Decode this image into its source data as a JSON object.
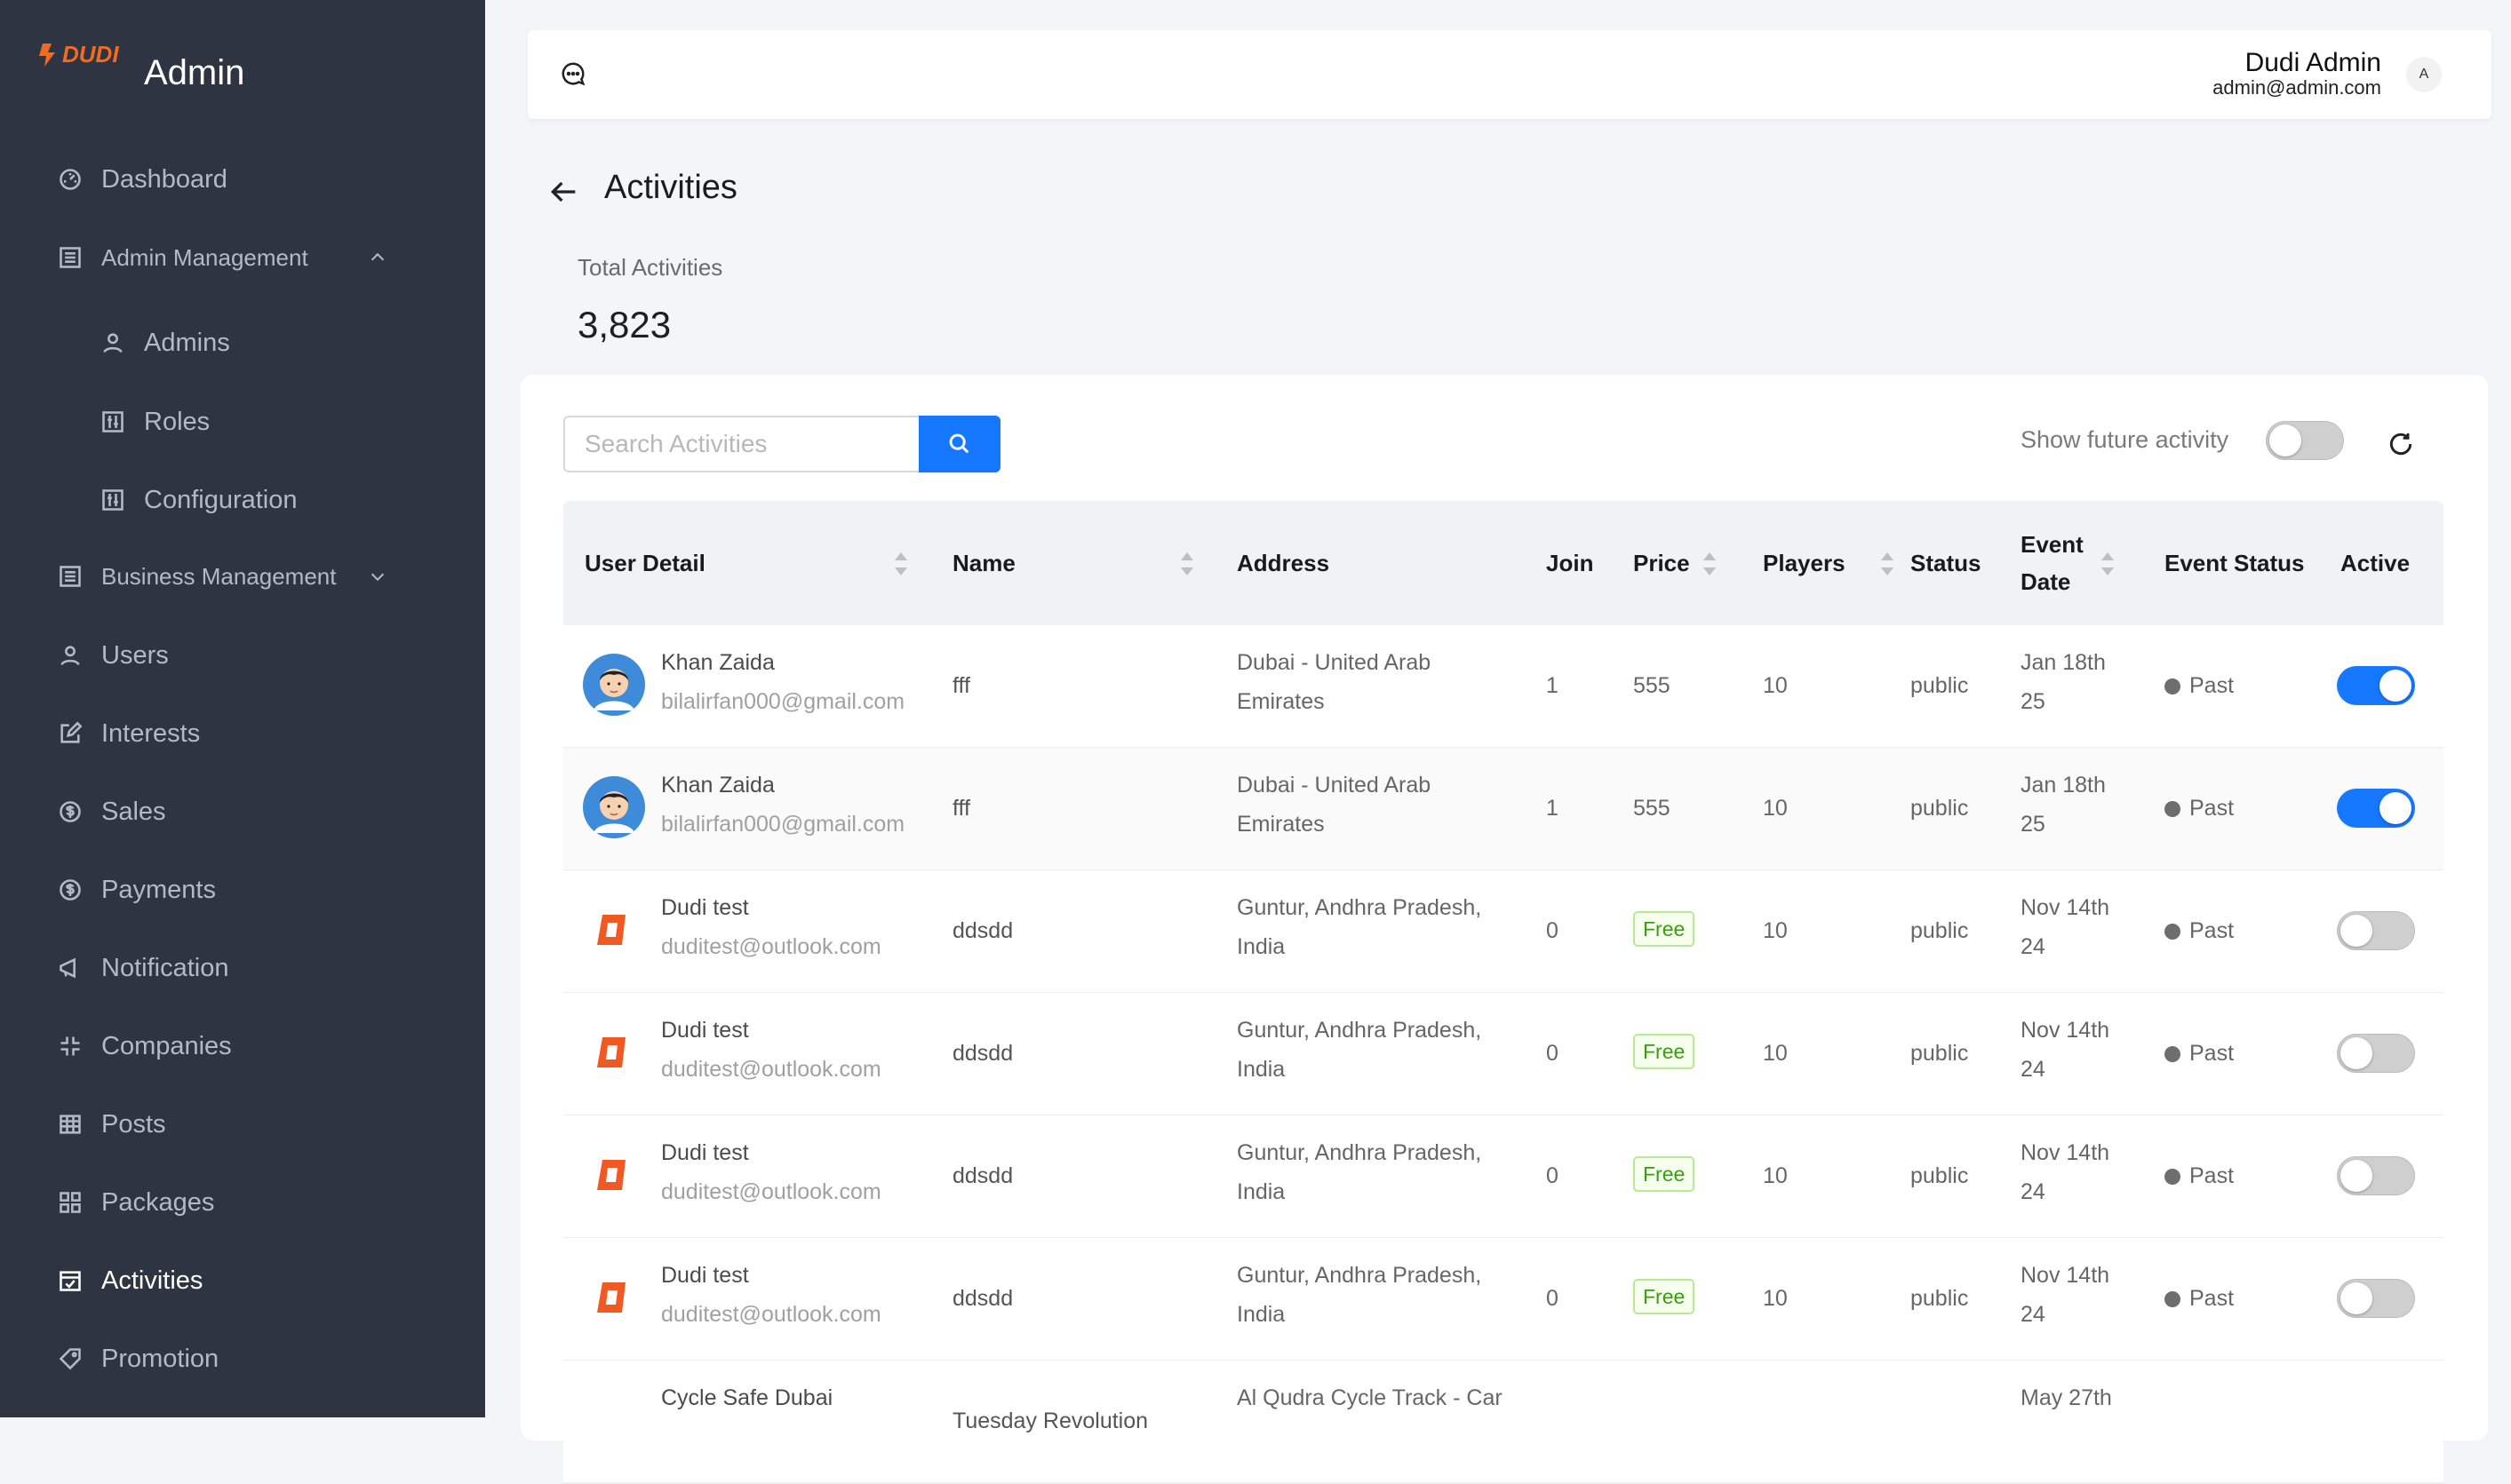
{
  "app": {
    "brand_logo_text": "DUDI",
    "title": "Admin"
  },
  "sidebar": {
    "items": [
      {
        "label": "Dashboard",
        "icon": "dashboard-icon"
      },
      {
        "label": "Admin Management",
        "icon": "list-icon",
        "expanded": true
      },
      {
        "label": "Admins",
        "icon": "user-icon"
      },
      {
        "label": "Roles",
        "icon": "settings-box-icon"
      },
      {
        "label": "Configuration",
        "icon": "settings-box-icon"
      },
      {
        "label": "Business Management",
        "icon": "list-icon",
        "expanded": false
      },
      {
        "label": "Users",
        "icon": "user-icon"
      },
      {
        "label": "Interests",
        "icon": "edit-icon"
      },
      {
        "label": "Sales",
        "icon": "dollar-circle-icon"
      },
      {
        "label": "Payments",
        "icon": "dollar-circle-icon"
      },
      {
        "label": "Notification",
        "icon": "megaphone-icon"
      },
      {
        "label": "Companies",
        "icon": "compress-icon"
      },
      {
        "label": "Posts",
        "icon": "table-icon"
      },
      {
        "label": "Packages",
        "icon": "grid-icon"
      },
      {
        "label": "Activities",
        "icon": "calendar-check-icon",
        "active": true
      },
      {
        "label": "Promotion",
        "icon": "tag-icon"
      }
    ]
  },
  "header": {
    "user_name": "Dudi Admin",
    "user_email": "admin@admin.com",
    "avatar_initial": "A"
  },
  "page": {
    "title": "Activities",
    "total_label": "Total Activities",
    "total_value": "3,823"
  },
  "toolbar": {
    "search_placeholder": "Search Activities",
    "future_label": "Show future activity",
    "future_enabled": false
  },
  "table": {
    "columns": [
      "User Detail",
      "Name",
      "Address",
      "Join",
      "Price",
      "Players",
      "Status",
      "Event Date",
      "Event Status",
      "Active"
    ],
    "event_date_header_lines": [
      "Event",
      "Date"
    ],
    "rows": [
      {
        "user_name": "Khan Zaida",
        "user_email": "bilalirfan000@gmail.com",
        "avatar": "person",
        "name": "fff",
        "address_1": "Dubai - United Arab",
        "address_2": "Emirates",
        "join": "1",
        "price": "555",
        "players": "10",
        "status": "public",
        "date_1": "Jan 18th",
        "date_2": "25",
        "event_status": "Past",
        "active": true
      },
      {
        "user_name": "Khan Zaida",
        "user_email": "bilalirfan000@gmail.com",
        "avatar": "person",
        "name": "fff",
        "address_1": "Dubai - United Arab",
        "address_2": "Emirates",
        "join": "1",
        "price": "555",
        "players": "10",
        "status": "public",
        "date_1": "Jan 18th",
        "date_2": "25",
        "event_status": "Past",
        "active": true
      },
      {
        "user_name": "Dudi test",
        "user_email": "duditest@outlook.com",
        "avatar": "dudi",
        "name": "ddsdd",
        "address_1": "Guntur, Andhra Pradesh,",
        "address_2": "India",
        "join": "0",
        "price": "Free",
        "players": "10",
        "status": "public",
        "date_1": "Nov 14th",
        "date_2": "24",
        "event_status": "Past",
        "active": false
      },
      {
        "user_name": "Dudi test",
        "user_email": "duditest@outlook.com",
        "avatar": "dudi",
        "name": "ddsdd",
        "address_1": "Guntur, Andhra Pradesh,",
        "address_2": "India",
        "join": "0",
        "price": "Free",
        "players": "10",
        "status": "public",
        "date_1": "Nov 14th",
        "date_2": "24",
        "event_status": "Past",
        "active": false
      },
      {
        "user_name": "Dudi test",
        "user_email": "duditest@outlook.com",
        "avatar": "dudi",
        "name": "ddsdd",
        "address_1": "Guntur, Andhra Pradesh,",
        "address_2": "India",
        "join": "0",
        "price": "Free",
        "players": "10",
        "status": "public",
        "date_1": "Nov 14th",
        "date_2": "24",
        "event_status": "Past",
        "active": false
      },
      {
        "user_name": "Dudi test",
        "user_email": "duditest@outlook.com",
        "avatar": "dudi",
        "name": "ddsdd",
        "address_1": "Guntur, Andhra Pradesh,",
        "address_2": "India",
        "join": "0",
        "price": "Free",
        "players": "10",
        "status": "public",
        "date_1": "Nov 14th",
        "date_2": "24",
        "event_status": "Past",
        "active": false
      },
      {
        "user_name": "Cycle Safe Dubai",
        "user_email": "",
        "avatar": "none",
        "name": "Tuesday Revolution",
        "address_1": "Al Qudra Cycle Track - Car",
        "address_2": "",
        "join": "",
        "price": "",
        "players": "",
        "status": "",
        "date_1": "May 27th",
        "date_2": "",
        "event_status": "",
        "active": null
      }
    ]
  }
}
